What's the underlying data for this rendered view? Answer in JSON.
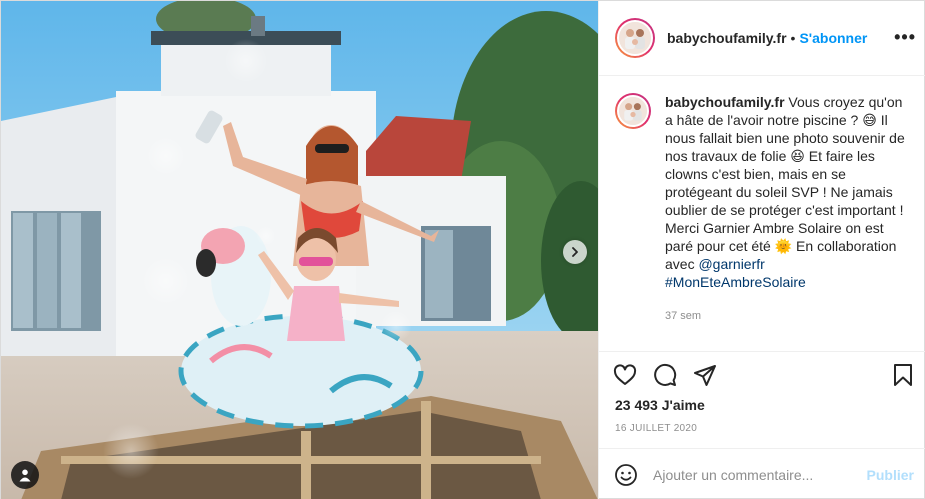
{
  "post": {
    "username": "babychoufamily.fr",
    "header_separator": "•",
    "follow_label": "S'abonner",
    "more_label": "•••",
    "caption": {
      "username": "babychoufamily.fr",
      "text_1": " Vous croyez qu'on a hâte de l'avoir notre piscine ? 😅 Il nous fallait bien une photo souvenir de nos travaux de folie 😆 Et faire les clowns c'est bien, mais en se protégeant du soleil SVP ! Ne jamais oublier de se protéger c'est important ! Merci Garnier Ambre Solaire on est paré pour cet été 🌞 En collaboration avec ",
      "mention": "@garnierfr",
      "hashtag": "#MonEteAmbreSolaire"
    },
    "time_ago": "37 sem",
    "likes": "23 493 J'aime",
    "date": "16 JUILLET 2020",
    "comment": {
      "placeholder": "Ajouter un commentaire...",
      "publish_label": "Publier"
    }
  },
  "icons": {
    "like": "heart-icon",
    "comment": "comment-icon",
    "share": "paper-plane-icon",
    "save": "bookmark-icon",
    "emoji": "smiley-icon",
    "next": "chevron-right-icon",
    "tagged": "user-tag-icon"
  },
  "colors": {
    "link_blue": "#0095f6",
    "publish_disabled": "#b2dffc",
    "mention": "#00376b",
    "secondary_text": "#8e8e8e"
  }
}
